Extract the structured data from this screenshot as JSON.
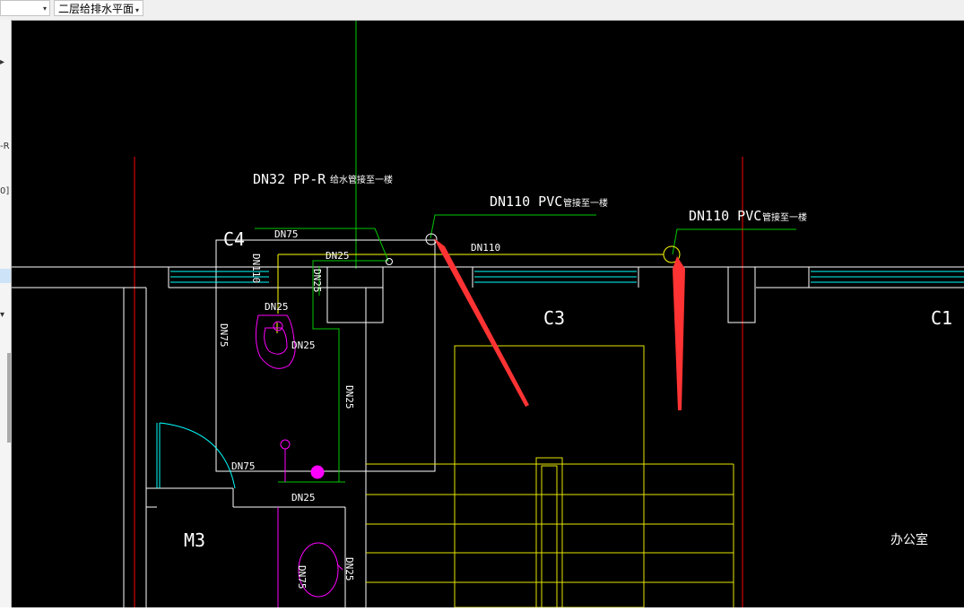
{
  "toolbar": {
    "left_combo": {
      "value": "",
      "arrow": "▾"
    },
    "floor_combo": {
      "value": "二层给排水平面",
      "arrow": "▾"
    }
  },
  "left_panel": {
    "fragments": [
      "▸",
      "-R",
      "0]",
      "▾"
    ]
  },
  "drawing": {
    "colors": {
      "background": "#000000",
      "wall": "#ffffff",
      "axis": "#ff0000",
      "water_supply": "#00c800",
      "drain": "#ffff00",
      "fixture": "#ff00ff",
      "window": "#00ffff",
      "arrow": "#ff3333"
    },
    "labels": {
      "dn32_ppr": "DN32 PP-R",
      "dn32_note": "给水管接至一楼",
      "dn110_pvc_1": "DN110 PVC",
      "dn110_note_1": "管接至一楼",
      "dn110_pvc_2": "DN110 PVC",
      "dn110_note_2": "管接至一楼",
      "dn110_pipe": "DN110",
      "dn75_top": "DN75",
      "dn25_top": "DN25",
      "dn110_vert": "DN110",
      "dn25_vert_a": "DN25",
      "dn25_fixture": "DN25",
      "dn75_vert": "DN75",
      "dn25_fixture_2": "DN25",
      "dn25_vert_b": "DN25",
      "dn75_bottom": "DN75",
      "dn25_bottom": "DN25",
      "dn75_vert_low": "DN75",
      "dn25_vert_low": "DN25",
      "window_c4": "C4",
      "window_c3": "C3",
      "window_c1": "C1",
      "door_m3": "M3",
      "room_office": "办公室"
    }
  }
}
